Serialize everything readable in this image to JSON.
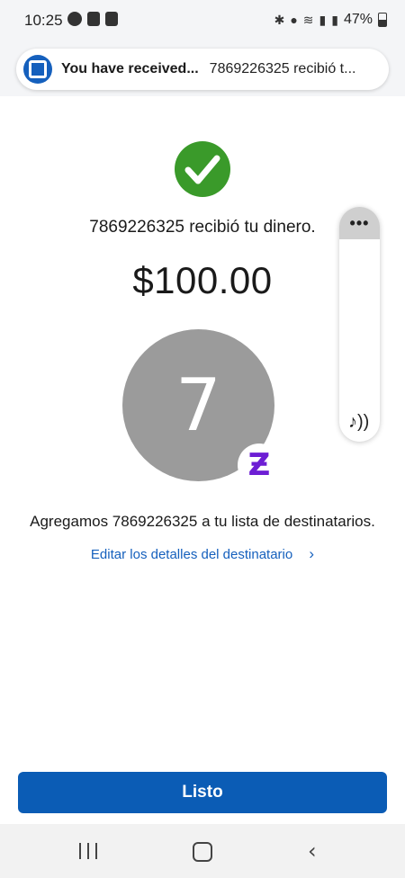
{
  "status_bar": {
    "time": "10:25",
    "left_icons": [
      "chase-app-icon",
      "store-app-icon",
      "bag-app-icon"
    ],
    "right_icons": [
      "bluetooth-icon",
      "location-icon",
      "wifi-icon",
      "signal-icon",
      "signal-icon-2"
    ],
    "battery_percent": "47%"
  },
  "notification": {
    "title": "You have received...",
    "body": "7869226325 recibió t...",
    "icon": "chase-logo-icon"
  },
  "confirmation": {
    "status_icon": "checkmark-icon",
    "message": "7869226325 recibió tu dinero.",
    "amount": "$100.00",
    "avatar_initial": "7",
    "badge_icon": "zelle-icon",
    "badge_glyph": "Ƶ"
  },
  "side_panel": {
    "menu_glyph": "•••",
    "music_glyph": "♪))"
  },
  "recipient": {
    "added_message": "Agregamos 7869226325 a tu lista de destinatarios.",
    "edit_link": "Editar los detalles del destinatario",
    "edit_chevron": "›"
  },
  "actions": {
    "done_label": "Listo"
  },
  "nav_bar": {
    "back_glyph": "‹"
  },
  "colors": {
    "accent": "#0b5cb5",
    "link": "#1560bd",
    "success": "#3a9a2a",
    "avatar_bg": "#9b9b9b",
    "zelle": "#6d1ed4"
  }
}
